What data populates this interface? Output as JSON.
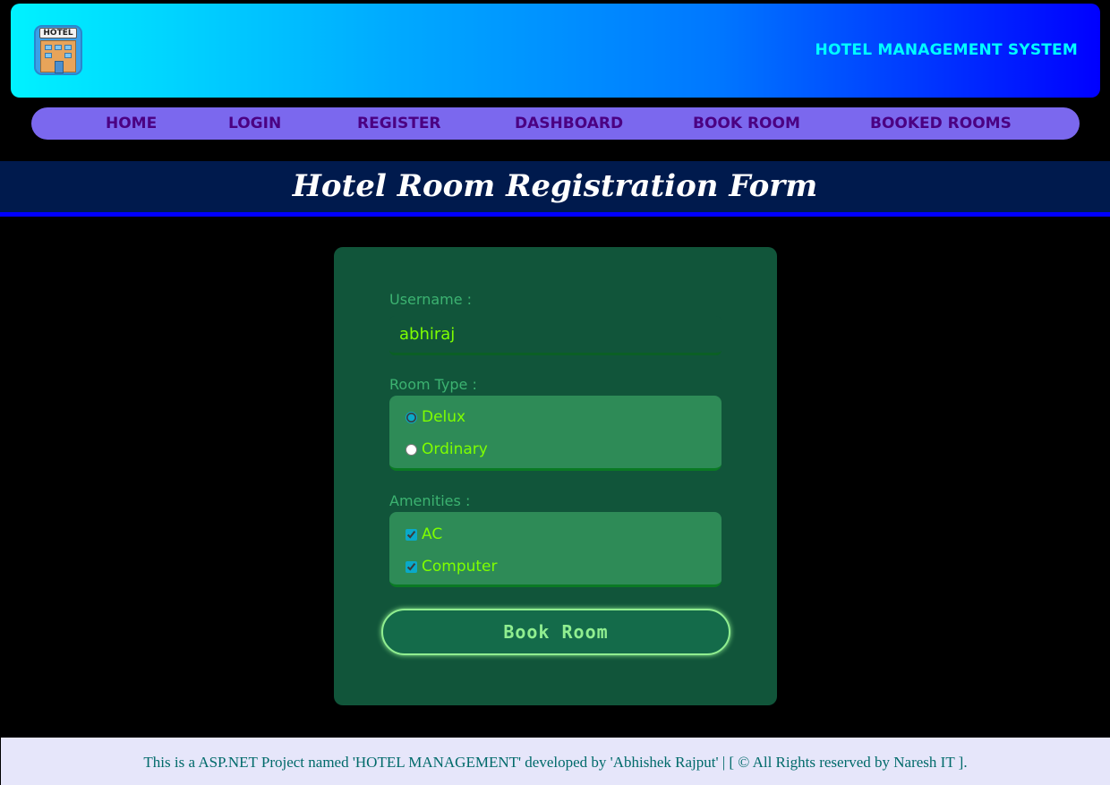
{
  "header": {
    "logo_text": "HOTEL",
    "site_title": "HOTEL MANAGEMENT SYSTEM"
  },
  "nav": {
    "items": [
      "HOME",
      "LOGIN",
      "REGISTER",
      "DASHBOARD",
      "BOOK ROOM",
      "BOOKED ROOMS"
    ]
  },
  "page": {
    "title": "Hotel Room Registration Form"
  },
  "form": {
    "username_label": "Username :",
    "username_value": "abhiraj",
    "room_type_label": "Room Type :",
    "room_types": [
      {
        "label": "Delux",
        "selected": true
      },
      {
        "label": "Ordinary",
        "selected": false
      }
    ],
    "amenities_label": "Amenities :",
    "amenities": [
      {
        "label": "AC",
        "checked": true
      },
      {
        "label": "Computer",
        "checked": true
      }
    ],
    "submit_label": "Book Room"
  },
  "footer": {
    "text": "This is a ASP.NET Project named 'HOTEL MANAGEMENT' developed by 'Abhishek Rajput' | [ © All Rights reserved by Naresh IT ]."
  },
  "colors": {
    "header_gradient_start": "#00f2ff",
    "header_gradient_end": "#0000ff",
    "nav_bg": "#7b68ee",
    "nav_text": "#4b0082",
    "card_bg": "#11553a",
    "accent_green": "#7fff00"
  }
}
